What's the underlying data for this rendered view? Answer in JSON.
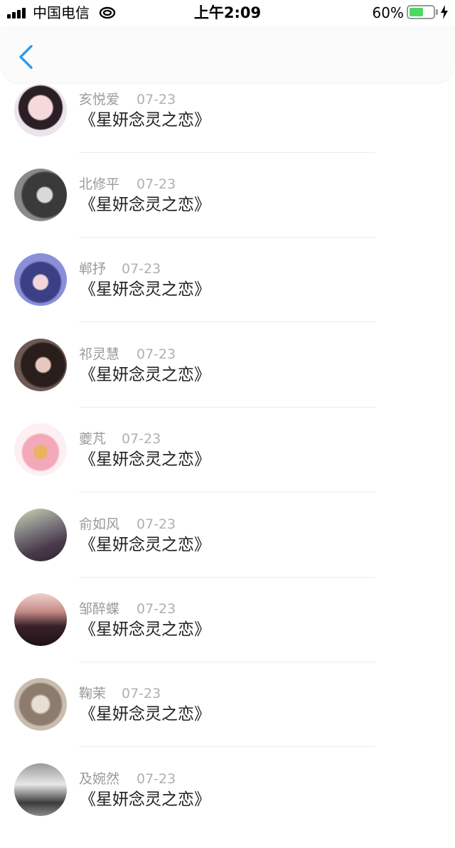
{
  "status_bar": {
    "carrier": "中国电信",
    "time": "上午2:09",
    "battery_percent": "60%",
    "battery_level": 0.6,
    "battery_color": "#4cd964",
    "icons": [
      "signal-icon",
      "wifi-icon",
      "battery-icon",
      "charging-icon"
    ]
  },
  "nav": {
    "back_icon": "chevron-left-icon",
    "accent": "#2f9bea"
  },
  "items": [
    {
      "name": "亥悦爱",
      "date": "07-23",
      "title": "《星妍念灵之恋》"
    },
    {
      "name": "北修平",
      "date": "07-23",
      "title": "《星妍念灵之恋》"
    },
    {
      "name": "郸抒",
      "date": "07-23",
      "title": "《星妍念灵之恋》"
    },
    {
      "name": "祁灵慧",
      "date": "07-23",
      "title": "《星妍念灵之恋》"
    },
    {
      "name": "夔芃",
      "date": "07-23",
      "title": "《星妍念灵之恋》"
    },
    {
      "name": "俞如风",
      "date": "07-23",
      "title": "《星妍念灵之恋》"
    },
    {
      "name": "邹醉蝶",
      "date": "07-23",
      "title": "《星妍念灵之恋》"
    },
    {
      "name": "鞠茉",
      "date": "07-23",
      "title": "《星妍念灵之恋》"
    },
    {
      "name": "及婉然",
      "date": "07-23",
      "title": "《星妍念灵之恋》"
    }
  ]
}
